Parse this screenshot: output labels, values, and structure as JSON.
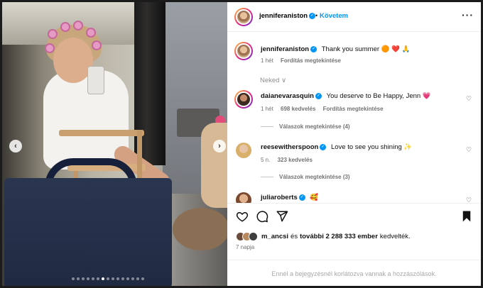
{
  "post": {
    "author": "jenniferaniston",
    "follow_label": "Követem",
    "caption_text": "Thank you summer 🟠 ❤️ 🙏",
    "caption_time": "1 hét",
    "caption_translate": "Fordítás megtekintése",
    "photo_dots_count": 15,
    "photo_active_dot": 6
  },
  "neked_label": "Neked ∨",
  "comments": [
    {
      "user": "daianevarasquin",
      "text": "You deserve to Be Happy, Jenn 💗",
      "time": "1 hét",
      "likes": "698 kedvelés",
      "translate": "Fordítás megtekintése",
      "replies": "Válaszok megtekintése (4)"
    },
    {
      "user": "reesewitherspoon",
      "text": "Love to see you shining ✨",
      "time": "5 n.",
      "likes": "323 kedvelés",
      "replies": "Válaszok megtekintése (3)"
    },
    {
      "user": "juliaroberts",
      "text": "🥰"
    }
  ],
  "likes_summary": {
    "first_user": "m_ancsi",
    "and": "és",
    "others": "további 2 288 333 ember",
    "suffix": "kedvelték."
  },
  "date_label": "7 napja",
  "comments_restricted": "Ennél a bejegyzésnél korlátozva vannak a hozzászólások.",
  "icons": {
    "like": "heart-icon",
    "comment": "comment-icon",
    "share": "share-icon",
    "save": "bookmark-icon",
    "verified": "verified-badge-icon"
  },
  "colors": {
    "link_blue": "#0095f6",
    "meta_gray": "#737373"
  }
}
